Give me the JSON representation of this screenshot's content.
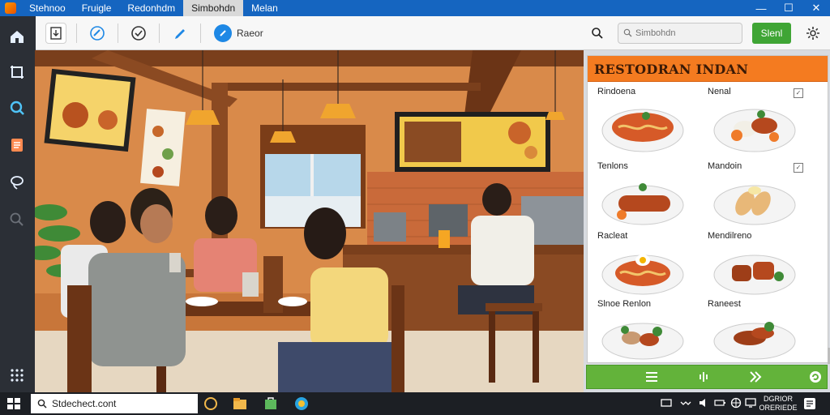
{
  "titlebar": {
    "menu": [
      "Stehnoo",
      "Fruigle",
      "Redonhdm",
      "Simbohdn",
      "Melan"
    ],
    "active_index": 3,
    "controls": {
      "minimize": "—",
      "maximize": "☐",
      "close": "✕"
    }
  },
  "toolbar": {
    "raster_label": "Raeor",
    "search_placeholder": "Simbohdn",
    "start_label": "Slenl"
  },
  "scene": {
    "kind": "illustration",
    "description_icons": [
      "restaurant-interior"
    ]
  },
  "panel": {
    "title": "RESTODRAN INDAN",
    "dishes": [
      {
        "label": "Rindoena",
        "checkbox": false
      },
      {
        "label": "Nenal",
        "checkbox": true
      },
      {
        "label": "Tenlons",
        "checkbox": false
      },
      {
        "label": "Mandoin",
        "checkbox": true
      },
      {
        "label": "Racleat",
        "checkbox": false
      },
      {
        "label": "Mendilreno",
        "checkbox": false
      },
      {
        "label": "Slnoe Renlon",
        "checkbox": false
      },
      {
        "label": "Raneest",
        "checkbox": false
      }
    ]
  },
  "taskbar": {
    "search_value": "Stdechect.cont",
    "clock_line1": "DGRIOR",
    "clock_line2": "ORERIEDE"
  },
  "colors": {
    "titlebar": "#1565c0",
    "panel_header": "#f47b20",
    "panel_footer": "#63b33a",
    "start_button": "#3fa535"
  }
}
